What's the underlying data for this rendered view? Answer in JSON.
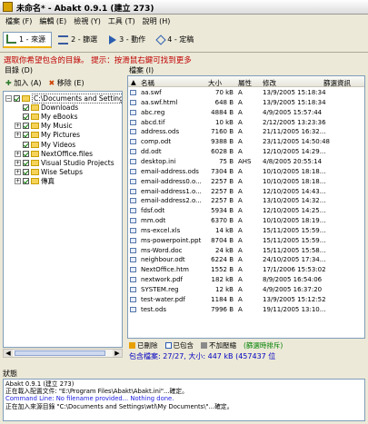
{
  "window": {
    "title": "未命名* - Abakt 0.9.1 (建立 273)"
  },
  "menu": [
    "檔案 (F)",
    "編輯 (E)",
    "檢視 (Y)",
    "工具 (T)",
    "說明 (H)"
  ],
  "tabs": [
    {
      "label": "1 - 來源"
    },
    {
      "label": "2 - 篩選"
    },
    {
      "label": "3 - 動作"
    },
    {
      "label": "4 - 定稿"
    }
  ],
  "hint": "選取你希望包含的目錄。 提示：按滑鼠右鍵可找到更多",
  "left_panel": {
    "title": "目錄 (D)",
    "add_label": "加入 (A)",
    "remove_label": "移除 (E)",
    "tree": [
      {
        "label": "C:\\Documents and Settings",
        "level": 0,
        "expander": "−"
      },
      {
        "label": "Downloads",
        "level": 1,
        "expander": ""
      },
      {
        "label": "My eBooks",
        "level": 1,
        "expander": ""
      },
      {
        "label": "My Music",
        "level": 1,
        "expander": "+"
      },
      {
        "label": "My Pictures",
        "level": 1,
        "expander": "+"
      },
      {
        "label": "My Videos",
        "level": 1,
        "expander": ""
      },
      {
        "label": "NextOffice.files",
        "level": 1,
        "expander": "+"
      },
      {
        "label": "Visual Studio Projects",
        "level": 1,
        "expander": "+"
      },
      {
        "label": "Wise Setups",
        "level": 1,
        "expander": "+"
      },
      {
        "label": "傳真",
        "level": 1,
        "expander": "+"
      }
    ]
  },
  "right_panel": {
    "title": "檔案 (I)",
    "columns": [
      "名稱",
      "大小",
      "屬性",
      "修改",
      "篩選資訊"
    ],
    "files": [
      [
        "aa.swf",
        "70 kB",
        "A",
        "13/9/2005 15:18:34"
      ],
      [
        "aa.swf.html",
        "648 B",
        "A",
        "13/9/2005 15:18:34"
      ],
      [
        "abc.reg",
        "4884 B",
        "A",
        "4/9/2005 15:57:44"
      ],
      [
        "abcd.tif",
        "10 kB",
        "A",
        "2/12/2005 13:23:36"
      ],
      [
        "address.ods",
        "7160 B",
        "A",
        "21/11/2005 16:32..."
      ],
      [
        "comp.odt",
        "9388 B",
        "A",
        "23/11/2005 14:50:48"
      ],
      [
        "dd.odt",
        "6028 B",
        "A",
        "12/10/2005 14:29..."
      ],
      [
        "desktop.ini",
        "75 B",
        "AHS",
        "4/8/2005 20:55:14"
      ],
      [
        "email-address.ods",
        "7304 B",
        "A",
        "10/10/2005 18:18..."
      ],
      [
        "email-address0.o...",
        "2257 B",
        "A",
        "10/10/2005 18:18..."
      ],
      [
        "email-address1.o...",
        "2257 B",
        "A",
        "12/10/2005 14:43..."
      ],
      [
        "email-address2.o...",
        "2257 B",
        "A",
        "13/10/2005 14:32..."
      ],
      [
        "fdsf.odt",
        "5934 B",
        "A",
        "12/10/2005 14:25..."
      ],
      [
        "mm.odt",
        "6370 B",
        "A",
        "10/10/2005 18:19..."
      ],
      [
        "ms-excel.xls",
        "14 kB",
        "A",
        "15/11/2005 15:59..."
      ],
      [
        "ms-powerpoint.ppt",
        "8704 B",
        "A",
        "15/11/2005 15:59..."
      ],
      [
        "ms-Word.doc",
        "24 kB",
        "A",
        "15/11/2005 15:58..."
      ],
      [
        "neighbour.odt",
        "6224 B",
        "A",
        "24/10/2005 17:34..."
      ],
      [
        "NextOffice.htm",
        "1552 B",
        "A",
        "17/1/2006 15:53:02"
      ],
      [
        "nextwork.pdf",
        "182 kB",
        "A",
        "8/9/2005 16:54:06"
      ],
      [
        "SYSTEM.reg",
        "12 kB",
        "A",
        "4/9/2005 16:37:20"
      ],
      [
        "test-water.pdf",
        "1184 B",
        "A",
        "13/9/2005 15:12:52"
      ],
      [
        "test.ods",
        "7996 B",
        "A",
        "19/11/2005 13:10..."
      ]
    ],
    "legend": [
      "已刪除",
      "已包含",
      "不加壓縮",
      "(篩選時排斥)"
    ],
    "summary": "包含檔案: 27/27, 大小: 447 kB (457437 位"
  },
  "status": {
    "label": "狀態",
    "lines": [
      {
        "text": "Abakt 0.9.1 (建立 273)",
        "blue": false
      },
      {
        "text": "正在載入配置文件: \"E:\\Program Files\\Abakt\\Abakt.ini\"...確定。",
        "blue": false
      },
      {
        "text": "Command Line: No filename provided... Nothing done.",
        "blue": true
      },
      {
        "text": "正在加入來源目錄 \"C:\\Documents and Settings\\wtl\\My Documents\\\"...確定。",
        "blue": false
      }
    ]
  },
  "colors": {
    "deleted": "#e8a000",
    "included": "#2a5db0",
    "nocompress": "#8a8a8a",
    "hint": "#c00000",
    "summary": "#0000c0"
  }
}
